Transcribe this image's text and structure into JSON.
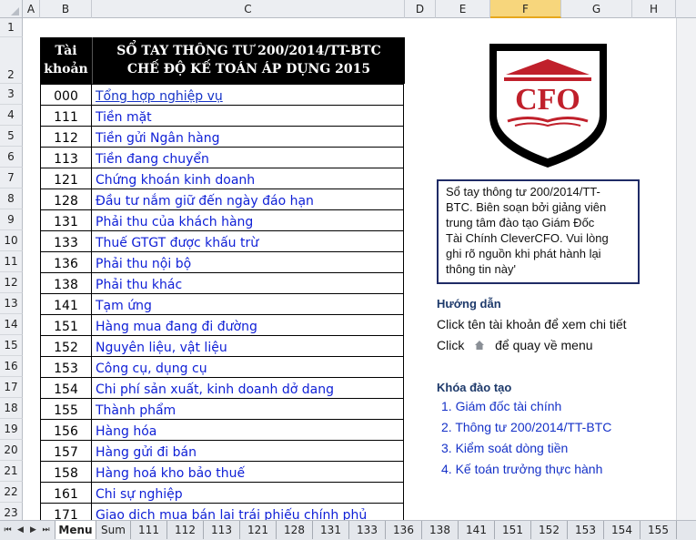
{
  "columns": [
    "A",
    "B",
    "C",
    "D",
    "E",
    "F",
    "G",
    "H"
  ],
  "selected_column": "F",
  "rows": [
    "1",
    "2",
    "3",
    "4",
    "5",
    "6",
    "7",
    "8",
    "9",
    "10",
    "11",
    "12",
    "13",
    "14",
    "15",
    "16",
    "17",
    "18",
    "19",
    "20",
    "21",
    "22",
    "23"
  ],
  "table": {
    "header_code_line1": "Tài",
    "header_code_line2": "khoản",
    "header_title_line1": "SỔ TAY THÔNG TƯ 200/2014/TT-BTC",
    "header_title_line2": "CHẾ ĐỘ KẾ TOÁN ÁP DỤNG 2015",
    "rows": [
      {
        "code": "000",
        "name": "Tổng hợp nghiệp vụ",
        "link": true
      },
      {
        "code": "111",
        "name": "Tiền mặt"
      },
      {
        "code": "112",
        "name": "Tiền gửi Ngân hàng"
      },
      {
        "code": "113",
        "name": "Tiền đang chuyển"
      },
      {
        "code": "121",
        "name": "Chứng khoán kinh doanh"
      },
      {
        "code": "128",
        "name": "Đầu tư nắm giữ đến ngày đáo hạn"
      },
      {
        "code": "131",
        "name": "Phải thu của khách hàng"
      },
      {
        "code": "133",
        "name": "Thuế GTGT được khấu trừ"
      },
      {
        "code": "136",
        "name": "Phải thu nội bộ"
      },
      {
        "code": "138",
        "name": "Phải thu khác"
      },
      {
        "code": "141",
        "name": "Tạm ứng"
      },
      {
        "code": "151",
        "name": "Hàng mua đang đi đường"
      },
      {
        "code": "152",
        "name": "Nguyên liệu, vật liệu"
      },
      {
        "code": "153",
        "name": "Công cụ, dụng cụ"
      },
      {
        "code": "154",
        "name": "Chi phí sản xuất, kinh doanh dở dang"
      },
      {
        "code": "155",
        "name": "Thành phẩm"
      },
      {
        "code": "156",
        "name": "Hàng hóa"
      },
      {
        "code": "157",
        "name": "Hàng gửi đi bán"
      },
      {
        "code": "158",
        "name": "Hàng hoá kho bảo thuế"
      },
      {
        "code": "161",
        "name": "Chi sự nghiệp"
      },
      {
        "code": "171",
        "name": "Giao dịch mua bán lại trái phiếu chính phủ"
      }
    ]
  },
  "logo": {
    "text": "CFO",
    "color": "#c0202b"
  },
  "info_box": {
    "lines": [
      "Sổ tay thông tư 200/2014/TT-",
      "BTC. Biên soạn bởi giảng viên",
      "trung tâm đào tạo Giám Đốc",
      "Tài Chính  CleverCFO. Vui lòng",
      "ghi rõ nguồn khi phát hành lại",
      "thông tin này'"
    ]
  },
  "guide": {
    "heading": "Hướng dẫn",
    "line1": "Click tên tài khoản để xem chi tiết",
    "line2_prefix": "Click",
    "line2_suffix": "để quay về menu",
    "home_icon": "home-icon"
  },
  "courses": {
    "heading": "Khóa đào tạo",
    "items": [
      "1. Giám đốc tài chính",
      "2. Thông tư 200/2014/TT-BTC",
      "3. Kiểm soát dòng tiền",
      "4. Kế toán trưởng thực hành"
    ]
  },
  "sheet_tabs": [
    "Menu",
    "Sum",
    "111",
    "112",
    "113",
    "121",
    "128",
    "131",
    "133",
    "136",
    "138",
    "141",
    "151",
    "152",
    "153",
    "154",
    "155"
  ],
  "active_tab": "Menu"
}
